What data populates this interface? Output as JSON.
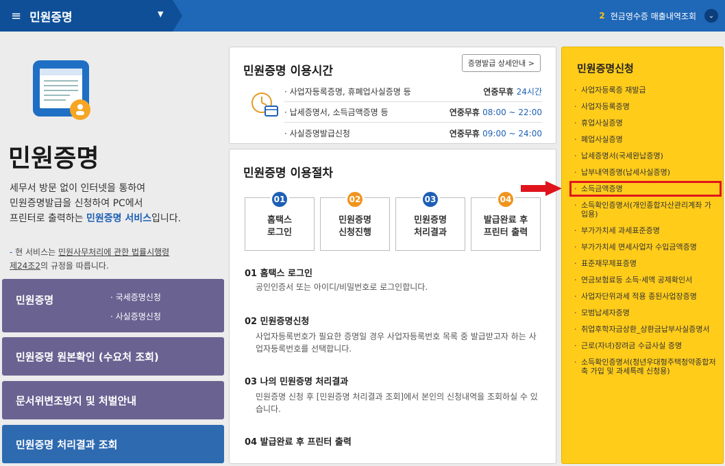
{
  "topbar": {
    "menu_title": "민원증명",
    "notice_number": "2",
    "notice_text": "현금영수증 매출내역조회"
  },
  "hero": {
    "title": "민원증명",
    "desc_line1": "세무서 방문 없이 인터넷을 통하여",
    "desc_line2": "민원증명발급을 신청하여 PC에서",
    "desc_line3_a": "프린터로 출력하는 ",
    "desc_line3_hl": "민원증명 서비스",
    "desc_line3_b": "입니다.",
    "note_dash": "-",
    "note_a": " 현 서비스는 ",
    "note_u1": "민원사무처리에 관한 법률시행령",
    "note_u2": "제24조2",
    "note_b": "의 규정을 따릅니다."
  },
  "left_buttons": {
    "btn1_label": "민원증명",
    "btn1_sub1": "· 국세증명신청",
    "btn1_sub2": "· 사실증명신청",
    "btn2_label": "민원증명 원본확인 (수요처 조회)",
    "btn3_label": "문서위변조방지 및 처벌안내",
    "btn4_label": "민원증명 처리결과 조회"
  },
  "hours": {
    "title": "민원증명 이용시간",
    "detail_button": "증명발급 상세안내 >",
    "rows": [
      {
        "name": "· 사업자등록증명, 휴폐업사실증명 등",
        "prefix": "연중무휴 ",
        "time": "24시간"
      },
      {
        "name": "· 납세증명서, 소득금액증명 등",
        "prefix": "연중무휴 ",
        "time": "08:00 ~ 22:00"
      },
      {
        "name": "· 사실증명발급신청",
        "prefix": "연중무휴 ",
        "time": "09:00 ~ 24:00"
      }
    ]
  },
  "procedure": {
    "title": "민원증명 이용절차",
    "steps": [
      {
        "num": "01",
        "line1": "홈택스",
        "line2": "로그인",
        "color": "#1d5fb5"
      },
      {
        "num": "02",
        "line1": "민원증명",
        "line2": "신청진행",
        "color": "#f0941e"
      },
      {
        "num": "03",
        "line1": "민원증명",
        "line2": "처리결과",
        "color": "#1d5fb5"
      },
      {
        "num": "04",
        "line1": "발급완료 후",
        "line2": "프린터 출력",
        "color": "#f0941e"
      }
    ],
    "sections": [
      {
        "title": "01 홈택스 로그인",
        "desc": "공인인증서 또는 아이디/비밀번호로 로그인합니다."
      },
      {
        "title": "02 민원증명신청",
        "desc": "사업자등록번호가 필요한 증명일 경우 사업자등록번호 목록 중 발급받고자 하는 사업자등록번호를 선택합니다."
      },
      {
        "title": "03 나의 민원증명 처리결과",
        "desc": "민원증명 신청 후 [민원증명 처리결과 조회]에서 본인의 신청내역을 조회하실 수 있습니다."
      },
      {
        "title": "04 발급완료 후 프린터 출력",
        "desc": ""
      }
    ]
  },
  "apply_panel": {
    "title": "민원증명신청",
    "items": [
      "사업자등록증 재발급",
      "사업자등록증명",
      "휴업사실증명",
      "폐업사실증명",
      "납세증명서(국세완납증명)",
      "납부내역증명(납세사실증명)",
      "소득금액증명",
      "소득확인증명서(개인종합자산관리계좌 가입용)",
      "부가가치세 과세표준증명",
      "부가가치세 면세사업자 수입금액증명",
      "표준재무제표증명",
      "연금보험료등 소득·세액 공제확인서",
      "사업자단위과세 적용 종된사업장증명",
      "모범납세자증명",
      "취업후학자금상환_상환금납부사실증명서",
      "근로(자녀)장려금 수급사실 증명",
      "소득확인증명서(청년우대형주택청약종합저축 가입 및 과세특례 신청용)"
    ],
    "highlight_color": "#e0141c"
  }
}
